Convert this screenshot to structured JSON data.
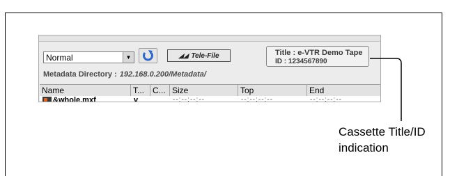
{
  "toolbar": {
    "mode_value": "Normal",
    "telefile_label": "Tele-File"
  },
  "cassette": {
    "title": "Title : e-VTR Demo Tape",
    "id": "ID : 1234567890"
  },
  "metadata_directory": {
    "label": "Metadata Directory :",
    "path": "192.168.0.200/Metadata/"
  },
  "columns": [
    "Name",
    "T...",
    "C...",
    "Size",
    "Top",
    "End"
  ],
  "rows": [
    {
      "name": "&whole.mxf",
      "t": "v",
      "c": "",
      "size": "--:--:--:--",
      "top": "--:--:--:--",
      "end": "--:--:--:--"
    }
  ],
  "annotation": {
    "text": "Cassette Title/ID\nindication"
  },
  "icons": {
    "refresh": "refresh-icon",
    "telefile": "telefile-icon",
    "file": "mxf-file-icon",
    "dropdown": "chevron-down-icon"
  },
  "colors": {
    "panel_bg": "#ececec",
    "refresh_blue": "#2f66c8",
    "callout_line": "#000000"
  }
}
